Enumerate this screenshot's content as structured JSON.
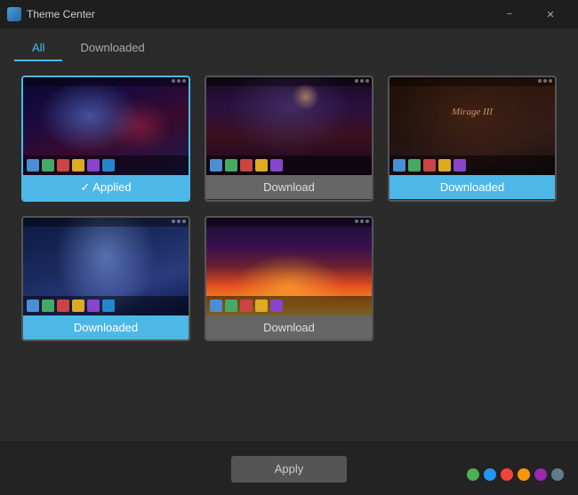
{
  "window": {
    "title": "Theme Center",
    "minimize_label": "−",
    "close_label": "✕"
  },
  "tabs": [
    {
      "id": "all",
      "label": "All",
      "active": true
    },
    {
      "id": "downloaded",
      "label": "Downloaded",
      "active": false
    }
  ],
  "themes": [
    {
      "id": "theme-1",
      "previewClass": "theme-preview-1",
      "status": "applied",
      "label": "✓ Applied"
    },
    {
      "id": "theme-2",
      "previewClass": "theme-preview-2",
      "status": "download",
      "label": "Download"
    },
    {
      "id": "theme-3",
      "previewClass": "theme-preview-3",
      "status": "downloaded",
      "label": "Downloaded"
    },
    {
      "id": "theme-4",
      "previewClass": "theme-preview-4",
      "status": "downloaded",
      "label": "Downloaded"
    },
    {
      "id": "theme-5",
      "previewClass": "theme-preview-5",
      "status": "download",
      "label": "Download"
    }
  ],
  "apply_button": {
    "label": "Apply"
  },
  "color_dots": [
    {
      "color": "#4CAF50",
      "name": "green"
    },
    {
      "color": "#2196F3",
      "name": "blue"
    },
    {
      "color": "#F44336",
      "name": "red"
    },
    {
      "color": "#FF9800",
      "name": "orange"
    },
    {
      "color": "#9C27B0",
      "name": "purple"
    },
    {
      "color": "#607D8B",
      "name": "grey"
    }
  ],
  "preview_icons": {
    "row1": [
      "#4a8fd4",
      "#44aa66",
      "#cc4444",
      "#ddaa22",
      "#8844cc",
      "#2288cc"
    ]
  }
}
